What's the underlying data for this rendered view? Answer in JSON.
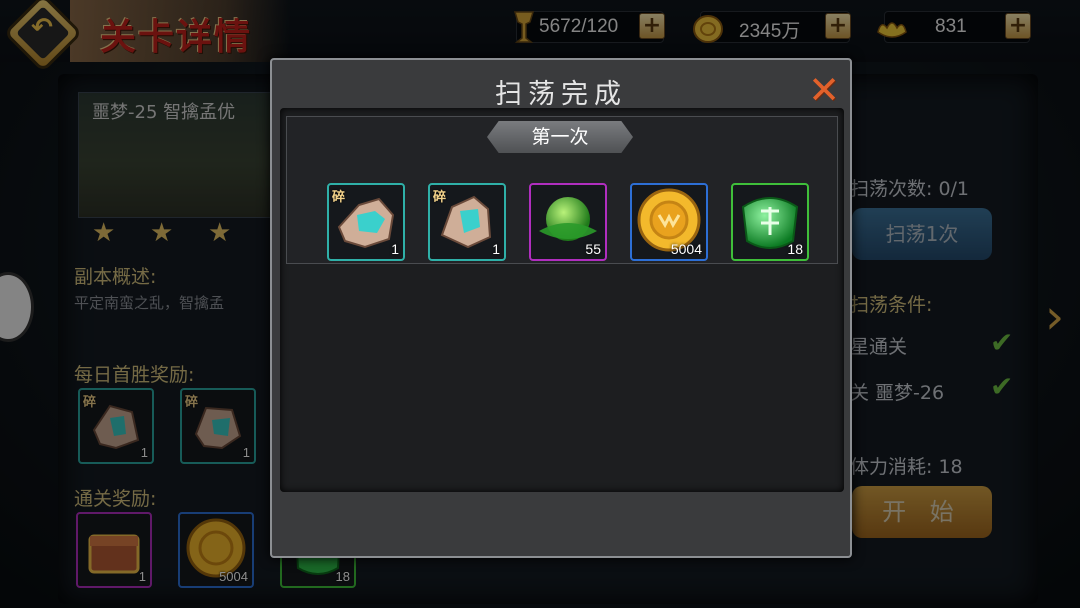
{
  "header": {
    "title": "关卡详情",
    "stamina": "5672/120",
    "copper": "2345万",
    "gold": "831",
    "plus_label": "+"
  },
  "background": {
    "stage_name": "噩梦-25 智擒孟优",
    "overview_label": "副本概述:",
    "overview_text": "平定南蛮之乱，智擒孟",
    "daily_reward_label": "每日首胜奖励:",
    "clear_reward_label": "通关奖励:",
    "daily_rewards": [
      {
        "icon": "map-fragment-icon",
        "tag": "碎",
        "count": "1"
      },
      {
        "icon": "map-fragment-icon",
        "tag": "碎",
        "count": "1"
      }
    ],
    "clear_rewards": [
      {
        "icon": "treasure-chest-icon",
        "count": "1"
      },
      {
        "icon": "gold-coin-icon",
        "count": "5004"
      },
      {
        "icon": "green-scripture-icon",
        "count": "18"
      }
    ],
    "sweep_count": "扫荡次数: 0/1",
    "sweep_button": "扫荡1次",
    "sweep_cond_label": "扫荡条件:",
    "cond1": "星通关",
    "cond2": "关 噩梦-26",
    "stamina_cost": "体力消耗: 18",
    "start_button": "开 始"
  },
  "modal": {
    "title": "扫荡完成",
    "round_label": "第一次",
    "rewards": [
      {
        "icon": "map-fragment-icon",
        "tag": "碎",
        "count": "1",
        "rarity": "teal"
      },
      {
        "icon": "map-fragment-icon",
        "tag": "碎",
        "count": "1",
        "rarity": "teal"
      },
      {
        "icon": "green-orb-icon",
        "tag": "",
        "count": "55",
        "rarity": "purple"
      },
      {
        "icon": "gold-coin-icon",
        "tag": "",
        "count": "5004",
        "rarity": "blue"
      },
      {
        "icon": "green-scripture-icon",
        "tag": "",
        "count": "18",
        "rarity": "green"
      }
    ]
  },
  "colors": {
    "accent_gold": "#d6c27f",
    "close_orange": "#e2612b",
    "teal": "#2fb0a8",
    "purple": "#b02ebf",
    "blue": "#2d6fd6",
    "green": "#3fbf3a"
  }
}
